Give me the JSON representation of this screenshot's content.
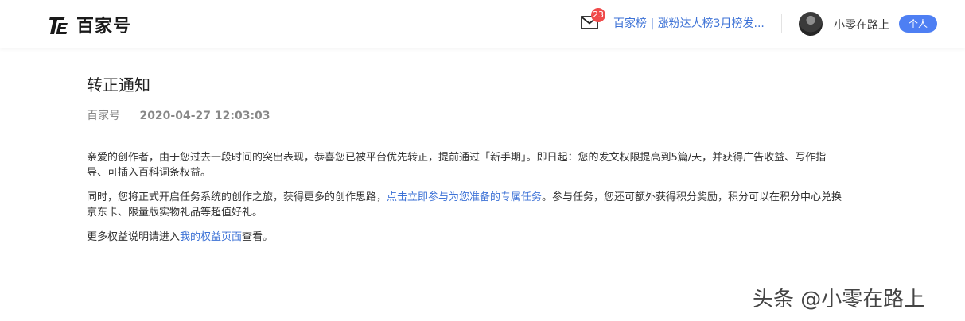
{
  "header": {
    "logo_text": "百家号",
    "mail_badge_count": "23",
    "notice_text": "百家榜 | 涨粉达人榜3月榜发...",
    "username": "小零在路上",
    "role_label": "个人"
  },
  "article": {
    "title": "转正通知",
    "source": "百家号",
    "datetime": "2020-04-27 12:03:03",
    "p1_line1": "亲爱的创作者，由于您过去一段时间的突出表现，恭喜您已被平台优先转正，提前通过「新手期」。即日起：您的发文权限提高到5篇/天，并获得广告收益、写作指",
    "p1_line2": "导、可插入百科词条权益。",
    "p2_before_link": "同时，您将正式开启任务系统的创作之旅，获得更多的创作思路，",
    "p2_link": "点击立即参与为您准备的专属任务",
    "p2_after_link": "。参与任务，您还可额外获得积分奖励，积分可以在积分中心兑换",
    "p2_line2": "京东卡、限量版实物礼品等超值好礼。",
    "p3_before_link": "更多权益说明请进入",
    "p3_link": "我的权益页面",
    "p3_after_link": "查看。"
  },
  "watermark": "头条 @小零在路上",
  "colors": {
    "accent": "#4e7ff3",
    "link": "#3d72d6",
    "badge": "#f04a4a"
  },
  "icons": [
    "baijiahao-logo-icon",
    "mail-icon",
    "user-avatar"
  ]
}
